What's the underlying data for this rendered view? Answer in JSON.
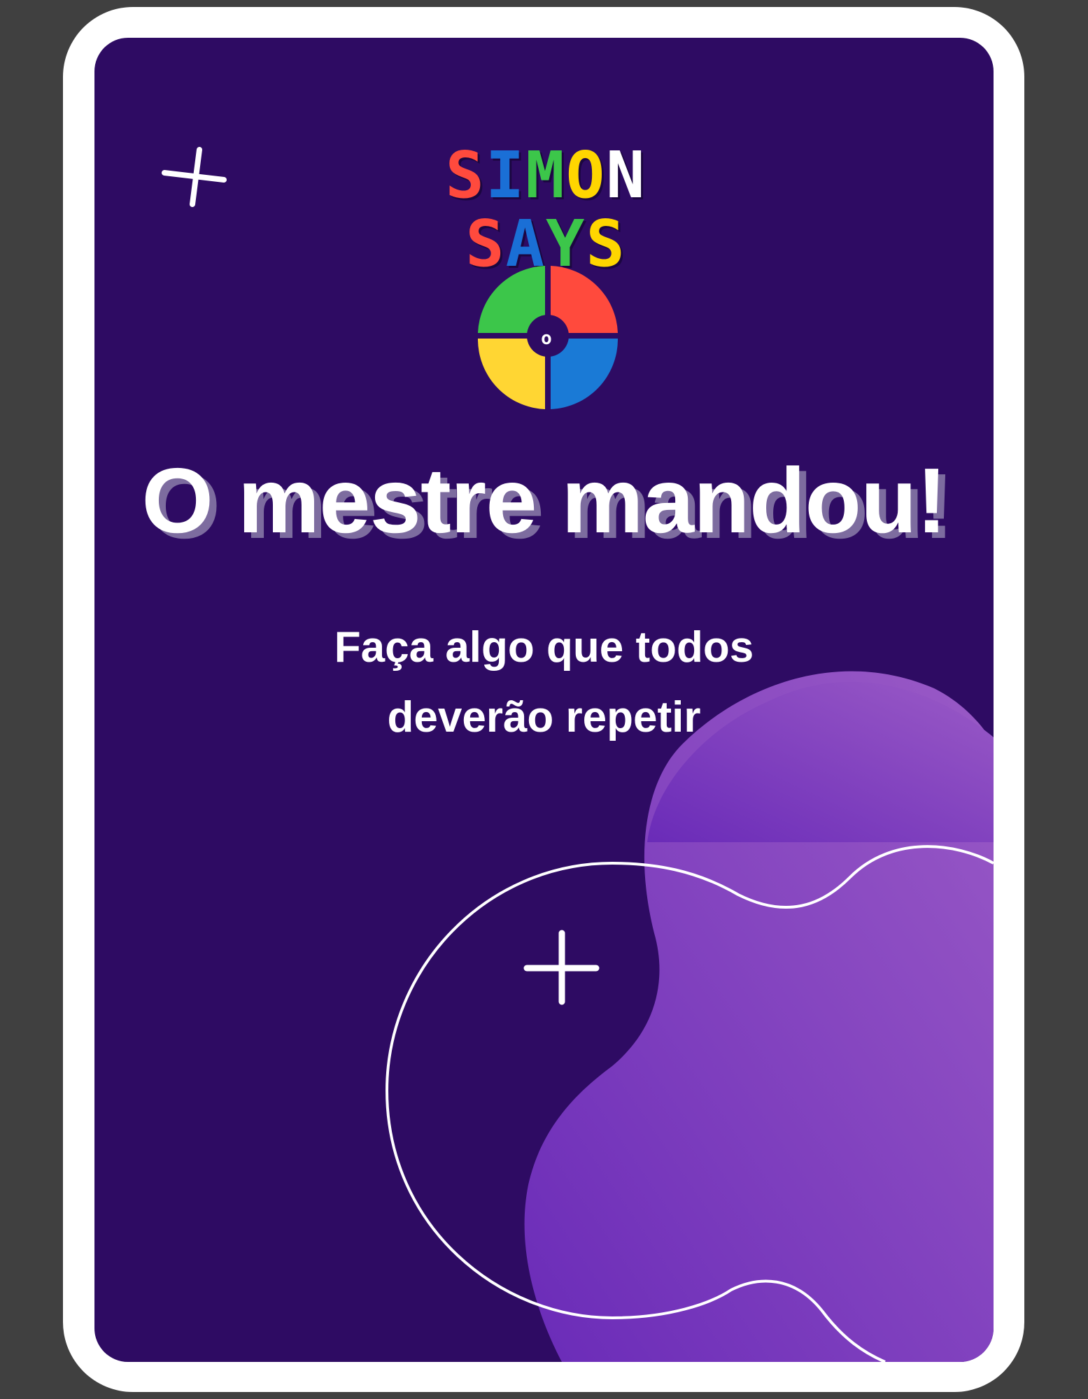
{
  "card": {
    "background_color": "#2e0b63",
    "border_color": "#ffffff",
    "blob_gradient": [
      "#6a2bb8",
      "#9a5ac6"
    ]
  },
  "logo": {
    "line1": [
      {
        "char": "S",
        "color": "#ff4a3d"
      },
      {
        "char": "I",
        "color": "#1a6fd6"
      },
      {
        "char": "M",
        "color": "#3cc64a"
      },
      {
        "char": "O",
        "color": "#ffd600"
      },
      {
        "char": "N",
        "color": "#ffffff"
      }
    ],
    "line2": [
      {
        "char": "S",
        "color": "#ff4a3d"
      },
      {
        "char": "A",
        "color": "#1a6fd6"
      },
      {
        "char": "Y",
        "color": "#3cc64a"
      },
      {
        "char": "S",
        "color": "#ffd600"
      }
    ],
    "wheel_colors": [
      "#3cc64a",
      "#ff4a3d",
      "#ffd633",
      "#1a7ad6"
    ],
    "wheel_center": "o"
  },
  "title": "O mestre mandou!",
  "instruction": {
    "line1": "Faça algo que todos",
    "line2": "deverão repetir"
  }
}
